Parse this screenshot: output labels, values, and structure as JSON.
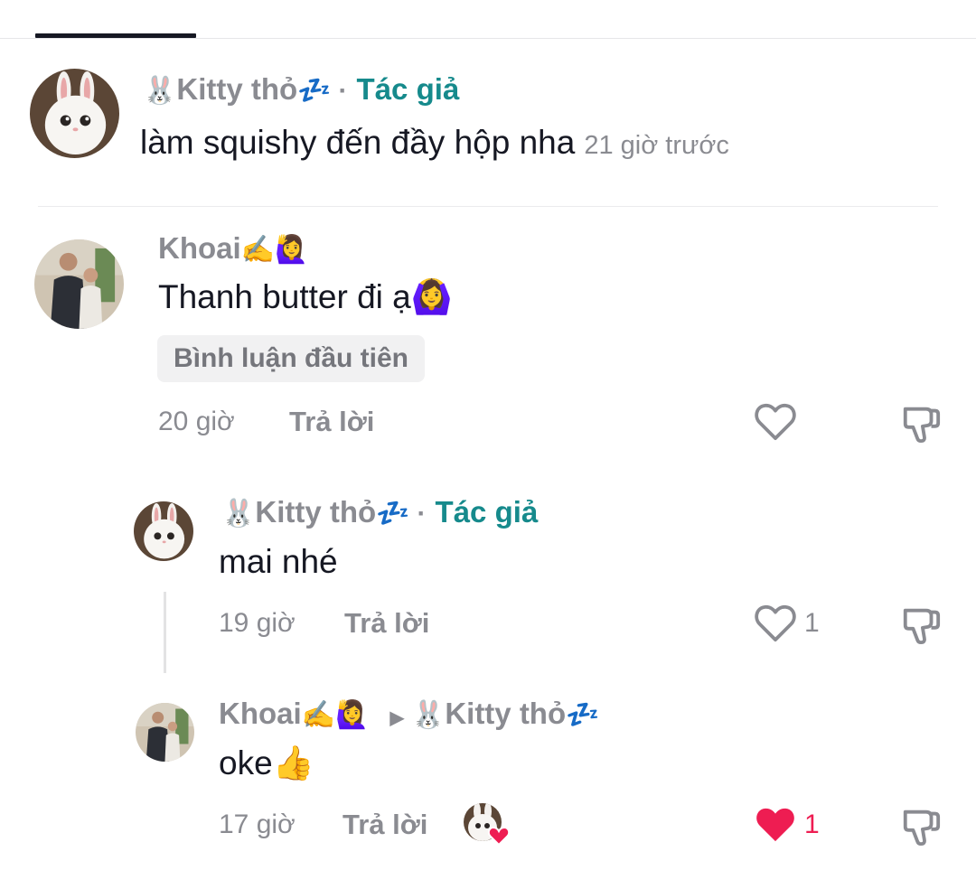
{
  "colors": {
    "author_tag": "#168a8c",
    "liked": "#ee1d52",
    "muted": "#8a8b91",
    "text": "#161823"
  },
  "comments": [
    {
      "username": "Kitty thỏ",
      "user_prefix_emoji": "🐰",
      "user_suffix_emoji": "💤",
      "author_tag": "Tác giả",
      "text": "làm squishy đến đầy hộp nha",
      "time": "21 giờ trước",
      "avatar": "rabbit-avatar"
    },
    {
      "username": "Khoai",
      "user_suffix_emoji": "✍️🙋‍♀️",
      "text": "Thanh butter đi ạ",
      "text_emoji": "🙆‍♀️",
      "badge": "Bình luận đầu tiên",
      "time": "20 giờ",
      "reply_label": "Trả lời",
      "avatar": "couple-photo-avatar",
      "like_icon": "heart-outline-icon",
      "dislike_icon": "thumbs-down-icon"
    }
  ],
  "replies": [
    {
      "username": "Kitty thỏ",
      "user_prefix_emoji": "🐰",
      "user_suffix_emoji": "💤",
      "author_tag": "Tác giả",
      "text": "mai nhé",
      "time": "19 giờ",
      "reply_label": "Trả lời",
      "like_count": "1",
      "avatar": "rabbit-avatar",
      "like_icon": "heart-outline-icon"
    },
    {
      "username": "Khoai",
      "user_suffix_emoji": "✍️🙋‍♀️",
      "reply_to": "Kitty thỏ",
      "reply_to_prefix_emoji": "🐰",
      "reply_to_suffix_emoji": "💤",
      "text": "oke",
      "text_emoji": "👍",
      "time": "17 giờ",
      "reply_label": "Trả lời",
      "like_count": "1",
      "liked": true,
      "avatar": "couple-photo-avatar",
      "like_icon": "heart-filled-icon",
      "creator_liked_icon": "creator-liked-avatar"
    }
  ]
}
